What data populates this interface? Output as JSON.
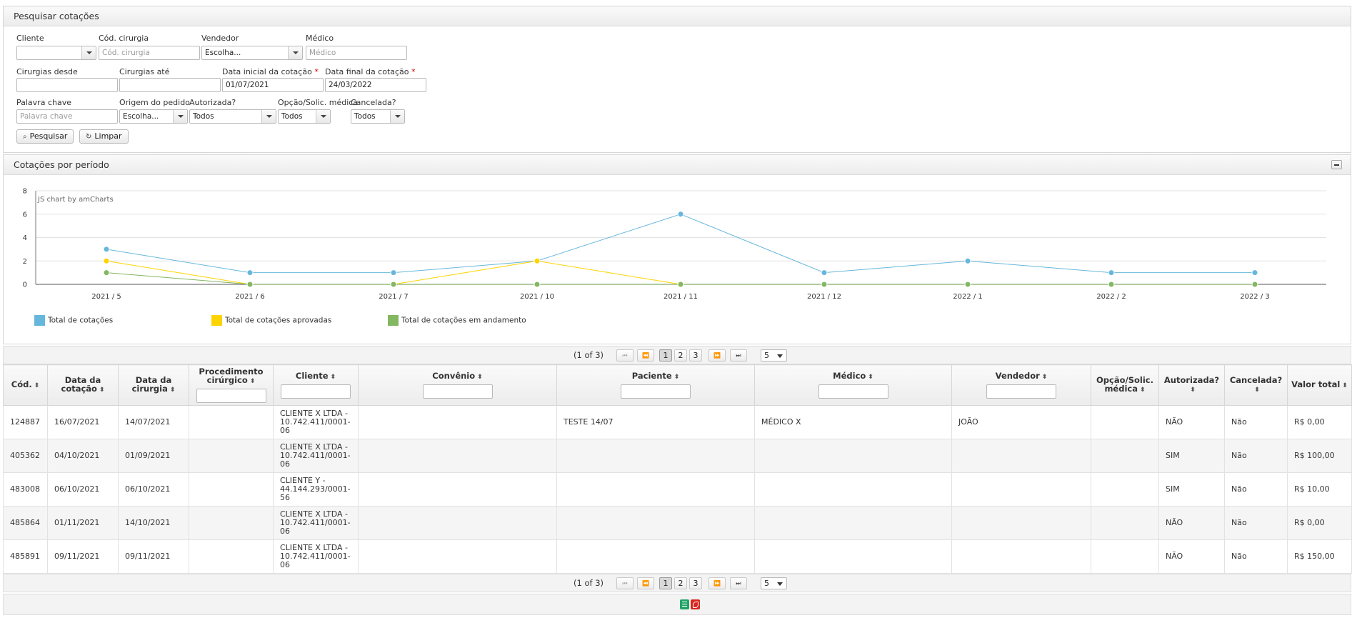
{
  "search": {
    "title": "Pesquisar cotações",
    "fields": {
      "cliente": {
        "label": "Cliente",
        "value": ""
      },
      "cod_cirurgia": {
        "label": "Cód. cirurgia",
        "placeholder": "Cód. cirurgia"
      },
      "vendedor": {
        "label": "Vendedor",
        "value": "Escolha..."
      },
      "medico": {
        "label": "Médico",
        "placeholder": "Médico"
      },
      "cirurgias_desde": {
        "label": "Cirurgias desde",
        "value": ""
      },
      "cirurgias_ate": {
        "label": "Cirurgias até",
        "value": ""
      },
      "data_inicial": {
        "label": "Data inicial da cotação",
        "required": "*",
        "value": "01/07/2021"
      },
      "data_final": {
        "label": "Data final da cotação",
        "required": "*",
        "value": "24/03/2022"
      },
      "palavra_chave": {
        "label": "Palavra chave",
        "placeholder": "Palavra chave"
      },
      "origem": {
        "label": "Origem do pedido",
        "value": "Escolha..."
      },
      "autorizada": {
        "label": "Autorizada?",
        "value": "Todos"
      },
      "opcao": {
        "label": "Opção/Solic. médica",
        "value": "Todos"
      },
      "cancelada": {
        "label": "Cancelada?",
        "value": "Todos"
      }
    },
    "buttons": {
      "search": "Pesquisar",
      "clear": "Limpar"
    }
  },
  "chart_panel": {
    "title": "Cotações por período",
    "credit": "JS chart by amCharts"
  },
  "chart_data": {
    "type": "line",
    "categories": [
      "2021 / 5",
      "2021 / 6",
      "2021 / 7",
      "2021 / 10",
      "2021 / 11",
      "2021 / 12",
      "2022 / 1",
      "2022 / 2",
      "2022 / 3"
    ],
    "series": [
      {
        "name": "Total de cotações",
        "color": "#67b7dc",
        "values": [
          3,
          1,
          1,
          2,
          6,
          1,
          2,
          1,
          1
        ]
      },
      {
        "name": "Total de cotações aprovadas",
        "color": "#fdd400",
        "values": [
          2,
          0,
          0,
          2,
          0,
          0,
          0,
          0,
          0
        ]
      },
      {
        "name": "Total de cotações em andamento",
        "color": "#84b761",
        "values": [
          1,
          0,
          0,
          0,
          0,
          0,
          0,
          0,
          0
        ]
      }
    ],
    "yticks": [
      "0",
      "2",
      "4",
      "6",
      "8"
    ],
    "ylim": [
      0,
      8
    ],
    "grid": true,
    "legend": "bottom"
  },
  "paginator": {
    "text": "(1 of 3)",
    "first": "⏮",
    "prev": "⏪",
    "next": "⏩",
    "last": "⏭",
    "pages": [
      "1",
      "2",
      "3"
    ],
    "rows": "5"
  },
  "table": {
    "columns": [
      {
        "label": "Cód.",
        "filter": false
      },
      {
        "label": "Data da cotação",
        "filter": false
      },
      {
        "label": "Data da cirurgia",
        "filter": false
      },
      {
        "label": "Procedimento cirúrgico",
        "filter": true
      },
      {
        "label": "Cliente",
        "filter": true
      },
      {
        "label": "Convênio",
        "filter": true
      },
      {
        "label": "Paciente",
        "filter": true
      },
      {
        "label": "Médico",
        "filter": true
      },
      {
        "label": "Vendedor",
        "filter": true
      },
      {
        "label": "Opção/Solic. médica",
        "filter": false
      },
      {
        "label": "Autorizada?",
        "filter": false
      },
      {
        "label": "Cancelada?",
        "filter": false
      },
      {
        "label": "Valor total",
        "filter": false
      }
    ],
    "rows": [
      [
        "124887",
        "16/07/2021",
        "14/07/2021",
        "",
        "CLIENTE X LTDA - 10.742.411/0001-06",
        "",
        "TESTE 14/07",
        "MÉDICO X",
        "JOÃO",
        "",
        "NÃO",
        "Não",
        "R$ 0,00"
      ],
      [
        "405362",
        "04/10/2021",
        "01/09/2021",
        "",
        "CLIENTE X LTDA - 10.742.411/0001-06",
        "",
        "",
        "",
        "",
        "",
        "SIM",
        "Não",
        "R$ 100,00"
      ],
      [
        "483008",
        "06/10/2021",
        "06/10/2021",
        "",
        "CLIENTE Y - 44.144.293/0001-56",
        "",
        "",
        "",
        "",
        "",
        "SIM",
        "Não",
        "R$ 10,00"
      ],
      [
        "485864",
        "01/11/2021",
        "14/10/2021",
        "",
        "CLIENTE X LTDA - 10.742.411/0001-06",
        "",
        "",
        "",
        "",
        "",
        "NÃO",
        "Não",
        "R$ 0,00"
      ],
      [
        "485891",
        "09/11/2021",
        "09/11/2021",
        "",
        "CLIENTE X LTDA - 10.742.411/0001-06",
        "",
        "",
        "",
        "",
        "",
        "NÃO",
        "Não",
        "R$ 150,00"
      ]
    ]
  },
  "export": {
    "icons": [
      "excel-icon",
      "pdf-icon"
    ]
  }
}
